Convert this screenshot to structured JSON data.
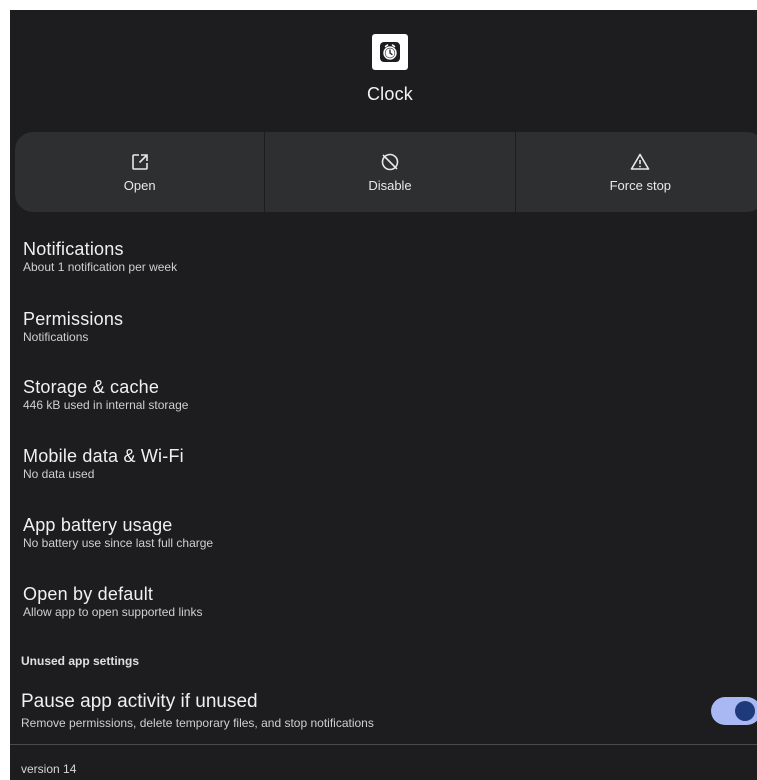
{
  "app": {
    "name": "Clock",
    "icon": "clock-icon"
  },
  "actions": [
    {
      "label": "Open",
      "icon": "open-external-icon"
    },
    {
      "label": "Disable",
      "icon": "disable-icon"
    },
    {
      "label": "Force stop",
      "icon": "warning-icon"
    }
  ],
  "settings": [
    {
      "title": "Notifications",
      "subtitle": "About 1 notification per week"
    },
    {
      "title": "Permissions",
      "subtitle": "Notifications"
    },
    {
      "title": "Storage & cache",
      "subtitle": "446 kB used in internal storage"
    },
    {
      "title": "Mobile data & Wi-Fi",
      "subtitle": "No data used"
    },
    {
      "title": "App battery usage",
      "subtitle": "No battery use since last full charge"
    },
    {
      "title": "Open by default",
      "subtitle": "Allow app to open supported links"
    }
  ],
  "unused_section": {
    "label": "Unused app settings",
    "pause": {
      "title": "Pause app activity if unused",
      "subtitle": "Remove permissions, delete temporary files, and stop notifications",
      "enabled": true
    }
  },
  "footer": {
    "version": "version 14"
  },
  "colors": {
    "background": "#1d1d1f",
    "action_bar": "#2e2f31",
    "toggle_track": "#a9b7f2",
    "toggle_knob": "#1e3a7a"
  }
}
